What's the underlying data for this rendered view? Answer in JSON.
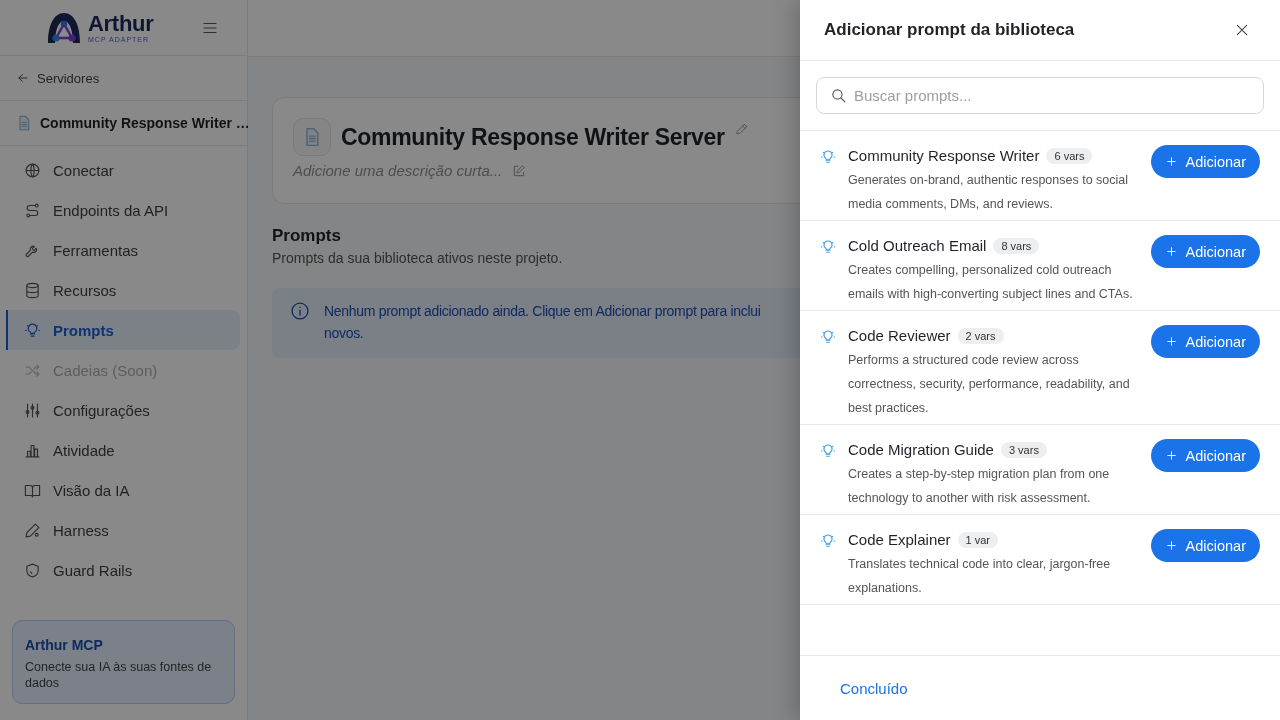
{
  "sidebar": {
    "logo": {
      "name": "Arthur",
      "tagline": "MCP ADAPTER"
    },
    "back_link": "Servidores",
    "server_name": "Community Response Writer …",
    "items": [
      {
        "label": "Conectar",
        "selected": false,
        "disabled": false
      },
      {
        "label": "Endpoints da API",
        "selected": false,
        "disabled": false
      },
      {
        "label": "Ferramentas",
        "selected": false,
        "disabled": false
      },
      {
        "label": "Recursos",
        "selected": false,
        "disabled": false
      },
      {
        "label": "Prompts",
        "selected": true,
        "disabled": false
      },
      {
        "label": "Cadeias (Soon)",
        "selected": false,
        "disabled": true
      },
      {
        "label": "Configurações",
        "selected": false,
        "disabled": false
      },
      {
        "label": "Atividade",
        "selected": false,
        "disabled": false
      },
      {
        "label": "Visão da IA",
        "selected": false,
        "disabled": false
      },
      {
        "label": "Harness",
        "selected": false,
        "disabled": false
      },
      {
        "label": "Guard Rails",
        "selected": false,
        "disabled": false
      }
    ],
    "promo": {
      "title": "Arthur MCP",
      "text": "Conecte sua IA às suas fontes de dados"
    }
  },
  "server_card": {
    "title": "Community Response Writer Server",
    "description": "Adicione uma descrição curta..."
  },
  "section": {
    "title": "Prompts",
    "subtitle": "Prompts da sua biblioteca ativos neste projeto."
  },
  "notice": {
    "lines": [
      "Nenhum prompt adicionado ainda. Clique em Adicionar prompt para inclui",
      "novos."
    ]
  },
  "drawer": {
    "title": "Adicionar prompt da biblioteca",
    "search": {
      "placeholder": "Buscar prompts..."
    },
    "prompts": [
      {
        "name": "Community Response Writer",
        "vars": "6 vars",
        "description": "Generates on-brand, authentic responses to social media comments, DMs, and reviews.",
        "button": "Adicionar"
      },
      {
        "name": "Cold Outreach Email",
        "vars": "8 vars",
        "description": "Creates compelling, personalized cold outreach emails with high-converting subject lines and CTAs.",
        "button": "Adicionar"
      },
      {
        "name": "Code Reviewer",
        "vars": "2 vars",
        "description": "Performs a structured code review across correctness, security, performance, readability, and best practices.",
        "button": "Adicionar"
      },
      {
        "name": "Code Migration Guide",
        "vars": "3 vars",
        "description": "Creates a step-by-step migration plan from one technology to another with risk assessment.",
        "button": "Adicionar"
      },
      {
        "name": "Code Explainer",
        "vars": "1 var",
        "description": "Translates technical code into clear, jargon-free explanations.",
        "button": "Adicionar"
      }
    ],
    "done_button": "Concluído"
  }
}
